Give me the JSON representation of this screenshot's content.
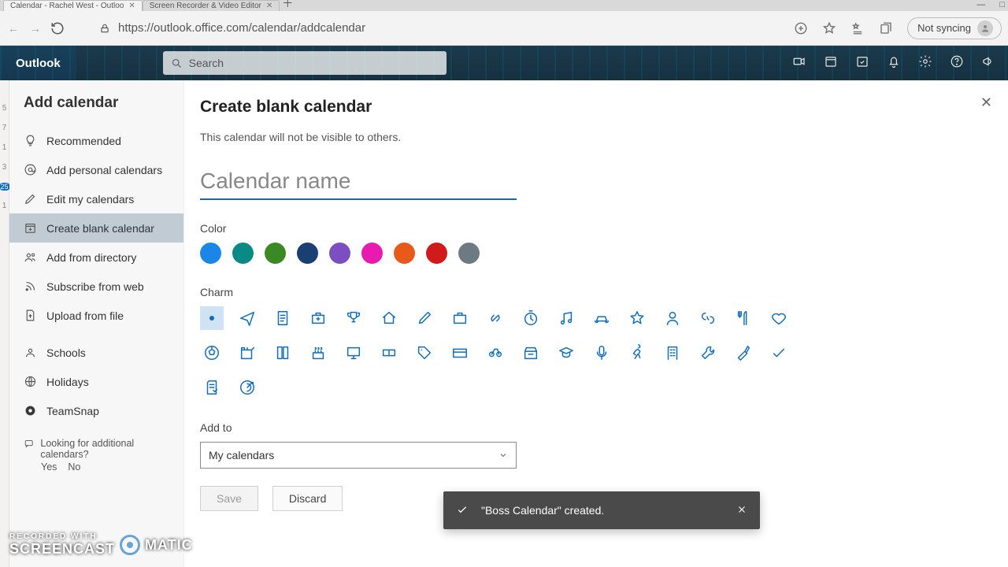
{
  "browser": {
    "tabs": [
      {
        "title": "Calendar - Rachel West - Outloo"
      },
      {
        "title": "Screen Recorder & Video Editor"
      }
    ],
    "url": "https://outlook.office.com/calendar/addcalendar",
    "not_syncing": "Not syncing"
  },
  "ribbon": {
    "brand": "Outlook",
    "search_placeholder": "Search"
  },
  "sidebar": {
    "title": "Add calendar",
    "items": [
      {
        "icon": "bulb",
        "label": "Recommended"
      },
      {
        "icon": "at",
        "label": "Add personal calendars"
      },
      {
        "icon": "pencil",
        "label": "Edit my calendars"
      },
      {
        "icon": "calendar",
        "label": "Create blank calendar",
        "active": true
      },
      {
        "icon": "people",
        "label": "Add from directory"
      },
      {
        "icon": "rss",
        "label": "Subscribe from web"
      },
      {
        "icon": "upload",
        "label": "Upload from file"
      },
      {
        "icon": "school",
        "label": "Schools"
      },
      {
        "icon": "globe",
        "label": "Holidays"
      },
      {
        "icon": "team",
        "label": "TeamSnap"
      }
    ],
    "foot_q": "Looking for additional calendars?",
    "yes": "Yes",
    "no": "No"
  },
  "leftstrip": [
    "5",
    "7",
    "1",
    "3",
    "25",
    "1"
  ],
  "main": {
    "heading": "Create blank calendar",
    "note": "This calendar will not be visible to others.",
    "name_placeholder": "Calendar name",
    "color_label": "Color",
    "colors": [
      "#1a86e8",
      "#0a8a84",
      "#3a8a24",
      "#1a3f73",
      "#7b4fc2",
      "#e81ab0",
      "#e85a1a",
      "#d11a1a",
      "#6e7a82"
    ],
    "charm_label": "Charm",
    "addto_label": "Add to",
    "addto_value": "My calendars",
    "save": "Save",
    "discard": "Discard"
  },
  "toast": {
    "message": "\"Boss Calendar\" created."
  },
  "watermark": {
    "top": "RECORDED WITH",
    "left": "SCREENCAST",
    "right": "MATIC"
  }
}
